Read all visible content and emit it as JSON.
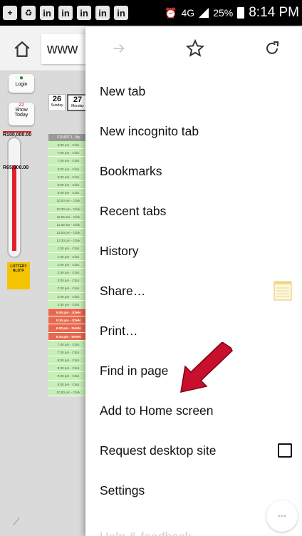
{
  "status_bar": {
    "network": "4G",
    "battery": "25%",
    "time": "8:14 PM",
    "left_icons": [
      "plus-square-icon",
      "recycle-icon",
      "linkedin-icon",
      "linkedin-icon",
      "linkedin-icon",
      "linkedin-icon",
      "linkedin-icon"
    ]
  },
  "toolbar": {
    "url_partial": "www"
  },
  "page": {
    "login_label": "Login",
    "show_today_label": "Show Today",
    "today_day": "22",
    "money_high": "R100,000.00",
    "money_low": "R65,000.00",
    "day_cards": [
      {
        "num": "26",
        "label": "Sunday"
      },
      {
        "num": "27",
        "label": "Monday"
      }
    ],
    "court_header": "COURT 1 - By",
    "lotto_text": "LOTTERY NLDTF",
    "gauge_level": 0.72,
    "slots": [
      {
        "t": "6:30 am - Click",
        "booked": false
      },
      {
        "t": "7:00 am - Click",
        "booked": false
      },
      {
        "t": "7:30 am - Click",
        "booked": false
      },
      {
        "t": "8:00 am - Click",
        "booked": false
      },
      {
        "t": "8:30 am - Click",
        "booked": false
      },
      {
        "t": "9:00 am - Click",
        "booked": false
      },
      {
        "t": "9:30 am - Click",
        "booked": false
      },
      {
        "t": "10:00 am - Click",
        "booked": false
      },
      {
        "t": "10:30 am - Click",
        "booked": false
      },
      {
        "t": "11:00 am - Click",
        "booked": false
      },
      {
        "t": "11:30 am - Click",
        "booked": false
      },
      {
        "t": "12:00 pm - Click",
        "booked": false
      },
      {
        "t": "12:30 pm - Click",
        "booked": false
      },
      {
        "t": "1:00 pm - Click",
        "booked": false
      },
      {
        "t": "1:30 pm - Click",
        "booked": false
      },
      {
        "t": "2:00 pm - Click",
        "booked": false
      },
      {
        "t": "2:30 pm - Click",
        "booked": false
      },
      {
        "t": "3:00 pm - Click",
        "booked": false
      },
      {
        "t": "3:30 pm - Click",
        "booked": false
      },
      {
        "t": "4:00 pm - Click",
        "booked": false
      },
      {
        "t": "4:30 pm - Click",
        "booked": false
      },
      {
        "t": "5:00 pm - JOHN",
        "booked": true
      },
      {
        "t": "5:30 pm - JOHN",
        "booked": true
      },
      {
        "t": "6:00 pm - SHAN",
        "booked": true
      },
      {
        "t": "6:30 pm - SHAN",
        "booked": true
      },
      {
        "t": "7:00 pm - Click",
        "booked": false
      },
      {
        "t": "7:30 pm - Click",
        "booked": false
      },
      {
        "t": "8:00 pm - Click",
        "booked": false
      },
      {
        "t": "8:30 pm - Click",
        "booked": false
      },
      {
        "t": "9:00 pm - Click",
        "booked": false
      },
      {
        "t": "9:30 pm - Click",
        "booked": false
      },
      {
        "t": "10:00 pm - Click",
        "booked": false
      }
    ]
  },
  "menu": {
    "top_icons": [
      "forward-arrow-icon",
      "star-icon",
      "reload-icon"
    ],
    "items": [
      {
        "name": "new-tab",
        "label": "New tab"
      },
      {
        "name": "new-incognito-tab",
        "label": "New incognito tab"
      },
      {
        "name": "bookmarks",
        "label": "Bookmarks"
      },
      {
        "name": "recent-tabs",
        "label": "Recent tabs"
      },
      {
        "name": "history",
        "label": "History"
      },
      {
        "name": "share",
        "label": "Share…"
      },
      {
        "name": "print",
        "label": "Print…"
      },
      {
        "name": "find-in-page",
        "label": "Find in page"
      },
      {
        "name": "add-to-home-screen",
        "label": "Add to Home screen"
      },
      {
        "name": "request-desktop-site",
        "label": "Request desktop site"
      },
      {
        "name": "settings",
        "label": "Settings"
      },
      {
        "name": "help-feedback",
        "label": "Help & feedback"
      }
    ],
    "request_desktop_checked": false,
    "arrow_color": "#c8102e"
  }
}
